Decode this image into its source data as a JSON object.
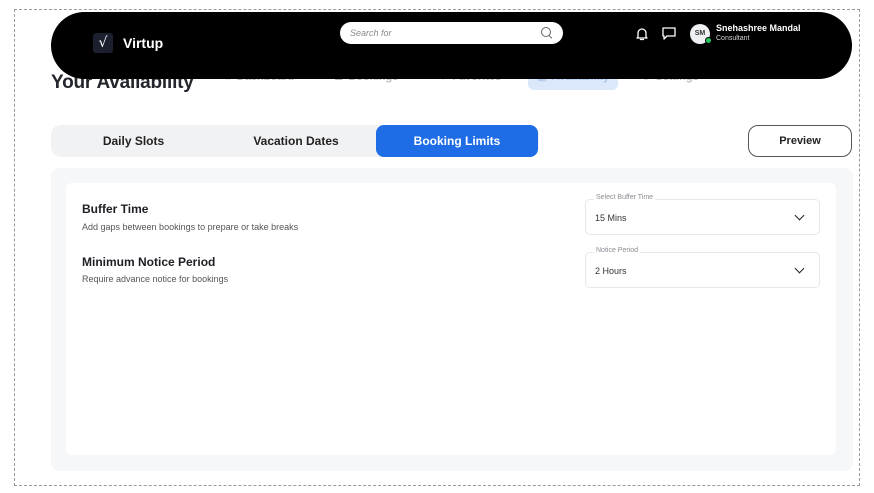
{
  "app": {
    "name": "Virtup",
    "logo_glyph": "√"
  },
  "search": {
    "placeholder": "Search for"
  },
  "user": {
    "name": "Snehashree Mandal",
    "role": "Consultant",
    "initials": "SM",
    "status_color": "#22c55e"
  },
  "nav": {
    "items": [
      {
        "label": "Dashboard",
        "icon": "grid-icon",
        "glyph": "⠿"
      },
      {
        "label": "Bookings",
        "icon": "list-icon",
        "glyph": "☰"
      },
      {
        "label": "Favorites",
        "icon": "heart-icon",
        "glyph": "♡"
      },
      {
        "label": "Availability",
        "icon": "calendar-icon",
        "glyph": "▦"
      },
      {
        "label": "Settings",
        "icon": "gear-icon",
        "glyph": "⚙"
      }
    ],
    "active": "Availability"
  },
  "page": {
    "title": "Your Availability"
  },
  "tabs": [
    {
      "label": "Daily Slots"
    },
    {
      "label": "Vacation Dates"
    },
    {
      "label": "Booking Limits"
    }
  ],
  "active_tab": "Booking Limits",
  "preview_label": "Preview",
  "settings": [
    {
      "title": "Buffer Time",
      "description": "Add gaps between bookings to prepare or take breaks",
      "select_label": "Select Buffer Time",
      "value": "15 Mins"
    },
    {
      "title": "Minimum Notice Period",
      "description": "Require advance notice for bookings",
      "select_label": "Notice Period",
      "value": "2 Hours"
    }
  ],
  "colors": {
    "accent": "#1e6de6",
    "header_bg": "#000000"
  }
}
